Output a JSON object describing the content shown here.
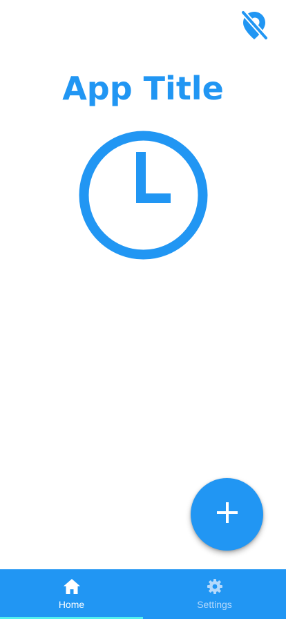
{
  "colors": {
    "primary": "#2196f3",
    "white": "#ffffff",
    "inactive_label": "#b5d9fb",
    "indicator": "#54f0ee"
  },
  "header": {
    "title": "App Title",
    "action_icon": "location-off-icon"
  },
  "main": {
    "clock_icon": "clock-icon"
  },
  "fab": {
    "icon": "plus-icon"
  },
  "bottom_nav": {
    "items": [
      {
        "label": "Home",
        "icon": "home-icon",
        "active": true
      },
      {
        "label": "Settings",
        "icon": "gear-icon",
        "active": false
      }
    ]
  }
}
